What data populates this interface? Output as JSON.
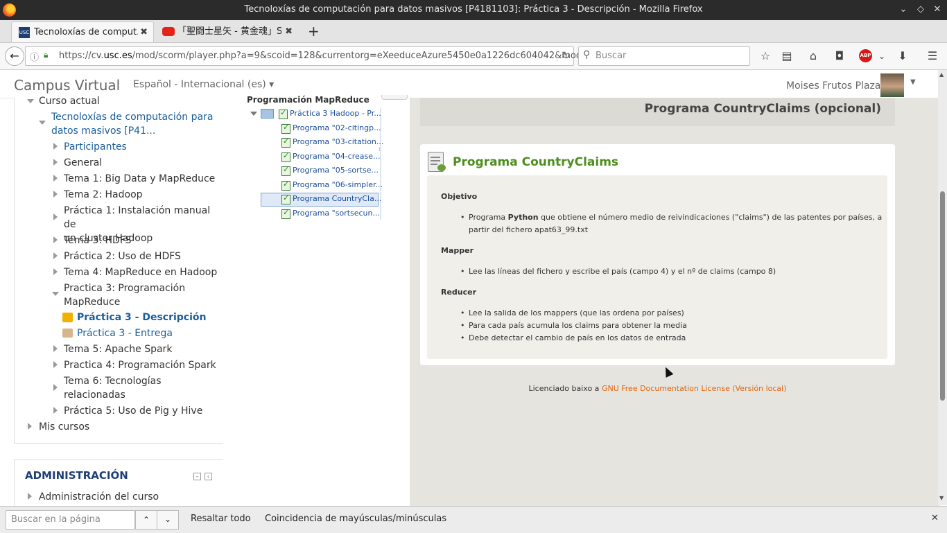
{
  "window": {
    "title": "Tecnoloxías de computación para datos masivos [P4181103]: Práctica 3 - Descripción - Mozilla Firefox"
  },
  "tabs": [
    {
      "label": "Tecnoloxías de comput..."
    },
    {
      "label": "「聖闘士星矢 - 黄金魂」Sa..."
    }
  ],
  "nav": {
    "url_prefix": "https://cv.",
    "url_domain": "usc.es",
    "url_suffix": "/mod/scorm/player.php?a=9&scoid=128&currentorg=eXeeduceAzure5450e0a1226dc604042&mod",
    "search_placeholder": "Buscar",
    "abp_label": "ABP"
  },
  "header": {
    "brand": "Campus Virtual",
    "language": "Español - Internacional (es)",
    "user": "Moises Frutos Plaza"
  },
  "sidebar": {
    "curso_actual": "Curso actual",
    "course_line1": "Tecnoloxías de computación para",
    "course_line2": "datos masivos [P41...",
    "items": [
      {
        "label": "Participantes"
      },
      {
        "label": "General"
      },
      {
        "label": "Tema 1: Big Data y MapReduce"
      },
      {
        "label": "Tema 2: Hadoop"
      },
      {
        "label": "Práctica 1: Instalación manual de",
        "label2": "un cluster Hadoop"
      },
      {
        "label": "Tema 3: HDFS"
      },
      {
        "label": "Práctica 2: Uso de HDFS"
      },
      {
        "label": "Tema 4: MapReduce en Hadoop"
      },
      {
        "label": "Practica 3: Programación",
        "label2": "MapReduce"
      },
      {
        "label": "Práctica 3 - Descripción"
      },
      {
        "label": "Práctica 3 - Entrega"
      },
      {
        "label": "Tema 5: Apache Spark"
      },
      {
        "label": "Practica 4: Programación Spark"
      },
      {
        "label": "Tema 6: Tecnologías",
        "label2": "relacionadas"
      },
      {
        "label": "Práctica 5: Uso de Pig y Hive"
      }
    ],
    "mis_cursos": "Mis cursos",
    "admin_title": "ADMINISTRACIÓN",
    "admin_item": "Administración del curso"
  },
  "toc": {
    "title": "Programación MapReduce",
    "folder": "Práctica 3 Hadoop - Pr...",
    "items": [
      "Programa \"02-citingp...",
      "Programa \"03-citation...",
      "Programa \"04-crease...",
      "Programa \"05-sortse...",
      "Programa \"06-simpler...",
      "Programa CountryCla...",
      "Programa \"sortsecun..."
    ]
  },
  "content": {
    "header_title": "Programa CountryClaims (opcional)",
    "card_title": "Programa CountryClaims",
    "objetivo": "Objetivo",
    "obj_pre": "Programa ",
    "obj_bold": "Python",
    "obj_rest": " que obtiene el número medio de reivindicaciones (\"claims\") de las patentes por países, a",
    "obj_line2": "partir del fichero apat63_99.txt",
    "mapper": "Mapper",
    "mapper_item": "Lee las líneas del fichero y escribe el país (campo 4) y el nº de claims (campo 8)",
    "reducer": "Reducer",
    "reducer_items": [
      "Lee la salida de los mappers (que las ordena por países)",
      "Para cada país acumula los claims para obtener la media",
      "Debe detectar el cambio de país en los datos de entrada"
    ],
    "license_pre": "Licenciado baixo a ",
    "license_link": "GNU Free Documentation License (Versión local)"
  },
  "findbar": {
    "placeholder": "Buscar en la página",
    "highlight": "Resaltar todo",
    "match_case": "Coincidencia de mayúsculas/minúsculas"
  }
}
